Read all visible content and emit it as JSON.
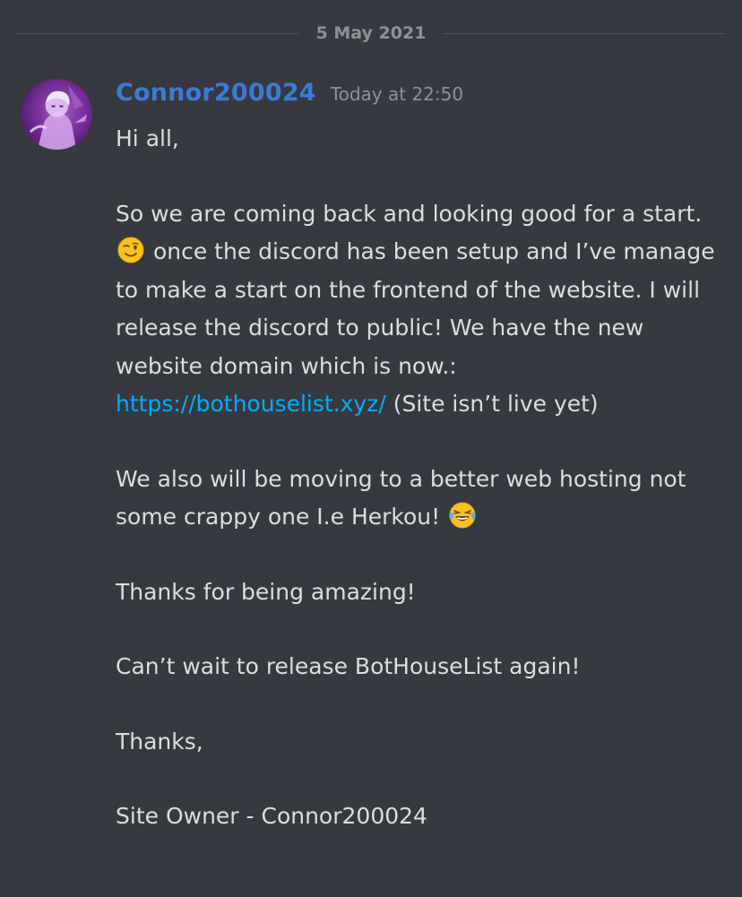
{
  "date_divider": "5 May 2021",
  "message": {
    "username": "Connor200024",
    "timestamp": "Today at 22:50",
    "user_color": "#3a7bd5",
    "lines": {
      "greeting": "Hi all,",
      "p2_part1": "So we are coming back and looking good for a start.",
      "p2_part2": "once the discord has been setup and I’ve manage to make a start on the frontend of the website. I will release the discord to public! We have the new website domain which is now.:",
      "link": "https://bothouselist.xyz/",
      "p2_part3": "(Site isn’t live yet)",
      "p3": "We also will be moving to a better web hosting not some crappy one I.e Herkou!",
      "p4": "Thanks for being amazing!",
      "p5": "Can’t wait to release BotHouseList again!",
      "p6": "Thanks,",
      "p7": "Site Owner - Connor200024"
    },
    "emojis": {
      "wink": "winking-face-emoji",
      "laugh": "face-with-tears-of-joy-emoji"
    }
  },
  "colors": {
    "background": "#36393f",
    "text": "#dcddde",
    "muted": "#8e9297",
    "link": "#00aff4"
  }
}
